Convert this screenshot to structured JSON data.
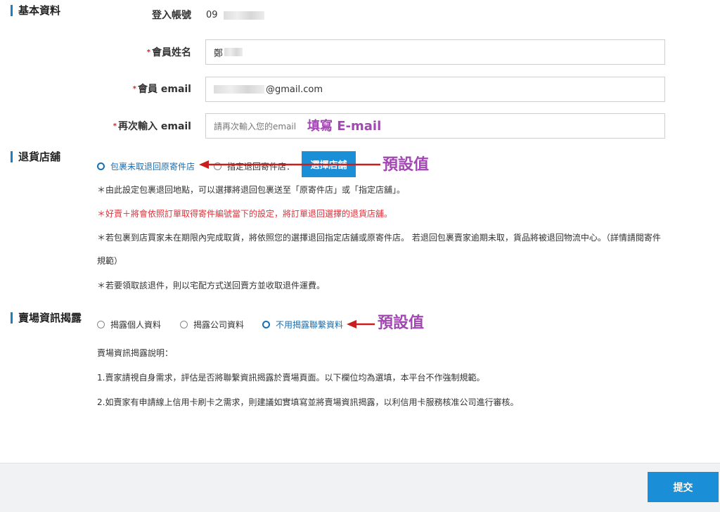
{
  "basic": {
    "section_title": "基本資料",
    "account_label": "登入帳號",
    "account_value": "09",
    "name_label": "會員姓名",
    "name_value": "鄭",
    "email_label": "會員 email",
    "email_value": "@gmail.com",
    "email2_label": "再次輸入 email",
    "email2_placeholder": "請再次輸入您的email",
    "required_mark": "*"
  },
  "return_store": {
    "section_title": "退貨店舖",
    "option_original": "包裹未取退回原寄件店",
    "option_specified": "指定退回寄件店：",
    "select_store_button": "選擇店舖",
    "notes": [
      "＊由此設定包裹退回地點，可以選擇將退回包裹送至「原寄件店」或「指定店舖」。",
      "＊好賣＋將會依照訂單取得寄件編號當下的設定，將訂單退回選擇的退貨店舖。",
      "＊若包裹到店買家未在期限內完成取貨，將依照您的選擇退回指定店舖或原寄件店。 若退回包裹賣家逾期未取，貨品將被退回物流中心。（詳情請閱寄件",
      "規範）",
      "＊若要領取該退件，則以宅配方式送回賣方並收取退件運費。"
    ]
  },
  "disclosure": {
    "section_title": "賣場資訊揭露",
    "option_personal": "揭露個人資料",
    "option_company": "揭露公司資料",
    "option_none": "不用揭露聯繫資料",
    "notes": [
      "賣場資訊揭露說明：",
      "1.賣家請視自身需求，評估是否將聯繫資訊揭露於賣場頁面。以下欄位均為選填，本平台不作強制規範。",
      "2.如賣家有申請線上信用卡刷卡之需求，則建議如實填寫並將賣場資訊揭露，以利信用卡服務核准公司進行審核。"
    ]
  },
  "annotations": {
    "fill_email": "填寫 E-mail",
    "default_value_1": "預設值",
    "default_value_2": "預設值"
  },
  "footer": {
    "submit_label": "提交"
  },
  "colors": {
    "accent": "#1a8fd8",
    "annotation": "#a347b3",
    "warning_text": "#e0313a",
    "arrow": "#c81e1e"
  }
}
